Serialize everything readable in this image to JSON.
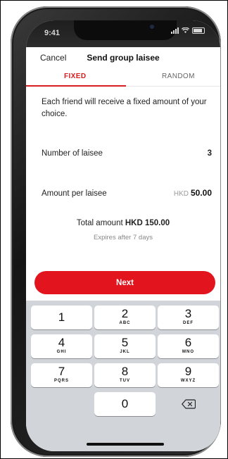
{
  "status": {
    "time": "9:41"
  },
  "nav": {
    "cancel": "Cancel",
    "title": "Send group laisee"
  },
  "tabs": [
    {
      "label": "FIXED",
      "active": true
    },
    {
      "label": "RANDOM",
      "active": false
    }
  ],
  "description": "Each friend will receive a fixed amount of your choice.",
  "number_of_laisee": {
    "label": "Number of laisee",
    "value": "3"
  },
  "amount_per_laisee": {
    "label": "Amount per laisee",
    "currency": "HKD",
    "value": "50.00"
  },
  "total": {
    "prefix": "Total amount",
    "value": "HKD 150.00"
  },
  "expires": "Expires after 7 days",
  "next_button": "Next",
  "keypad": [
    {
      "digit": "1",
      "letters": ""
    },
    {
      "digit": "2",
      "letters": "ABC"
    },
    {
      "digit": "3",
      "letters": "DEF"
    },
    {
      "digit": "4",
      "letters": "GHI"
    },
    {
      "digit": "5",
      "letters": "JKL"
    },
    {
      "digit": "6",
      "letters": "MNO"
    },
    {
      "digit": "7",
      "letters": "PQRS"
    },
    {
      "digit": "8",
      "letters": "TUV"
    },
    {
      "digit": "9",
      "letters": "WXYZ"
    },
    {
      "digit": "0",
      "letters": ""
    }
  ],
  "colors": {
    "accent": "#e2141d",
    "keypad_bg": "#d1d4d9"
  },
  "icons": {
    "delete": "backspace-icon"
  }
}
